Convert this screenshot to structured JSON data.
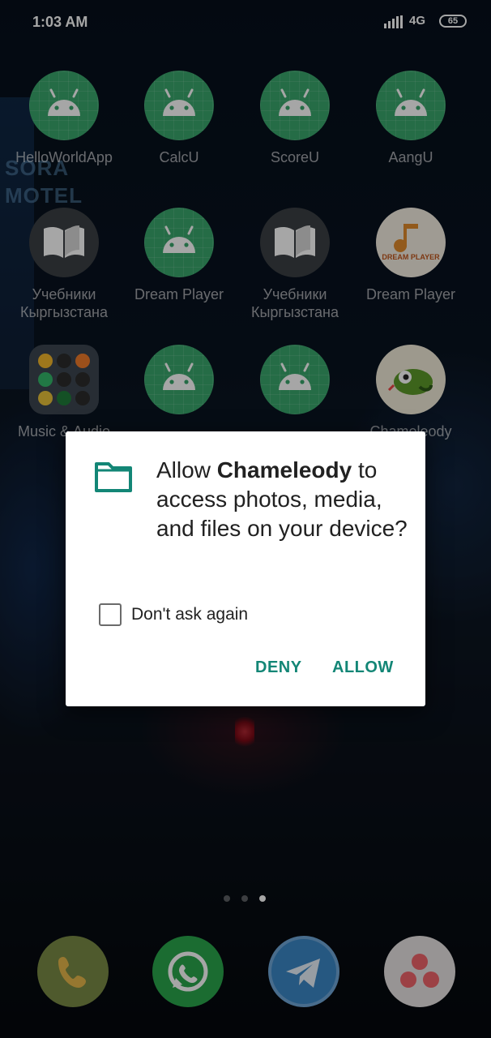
{
  "status_bar": {
    "time": "1:03 AM",
    "network": "4G",
    "battery": "65"
  },
  "wallpaper": {
    "sign_text": "SORA MOTEL"
  },
  "apps": [
    {
      "label": "HelloWorldApp",
      "icon": "android-icon"
    },
    {
      "label": "CalcU",
      "icon": "android-icon"
    },
    {
      "label": "ScoreU",
      "icon": "android-icon"
    },
    {
      "label": "AangU",
      "icon": "android-icon"
    },
    {
      "label": "Учебники Кыргызстана",
      "icon": "book-icon"
    },
    {
      "label": "Dream Player",
      "icon": "android-icon"
    },
    {
      "label": "Учебники Кыргызстана",
      "icon": "book-icon"
    },
    {
      "label": "Dream Player",
      "icon": "dream-player-icon",
      "icon_text": "DREAM PLAYER"
    },
    {
      "label": "Music & Audio",
      "icon": "folder-icon"
    },
    {
      "label": "",
      "icon": "android-icon"
    },
    {
      "label": "",
      "icon": "android-icon"
    },
    {
      "label": "Chameleody",
      "icon": "chameleon-icon"
    }
  ],
  "page_indicator": {
    "pages": 3,
    "current": 3
  },
  "dock": [
    {
      "name": "phone-icon"
    },
    {
      "name": "whatsapp-icon"
    },
    {
      "name": "telegram-icon"
    },
    {
      "name": "asana-icon"
    }
  ],
  "dialog": {
    "prefix": "Allow ",
    "app_name": "Chameleody",
    "suffix": " to access photos, media, and files on your device?",
    "checkbox_label": "Don't ask again",
    "checkbox_checked": false,
    "deny_label": "DENY",
    "allow_label": "ALLOW",
    "accent_color": "#138676"
  }
}
